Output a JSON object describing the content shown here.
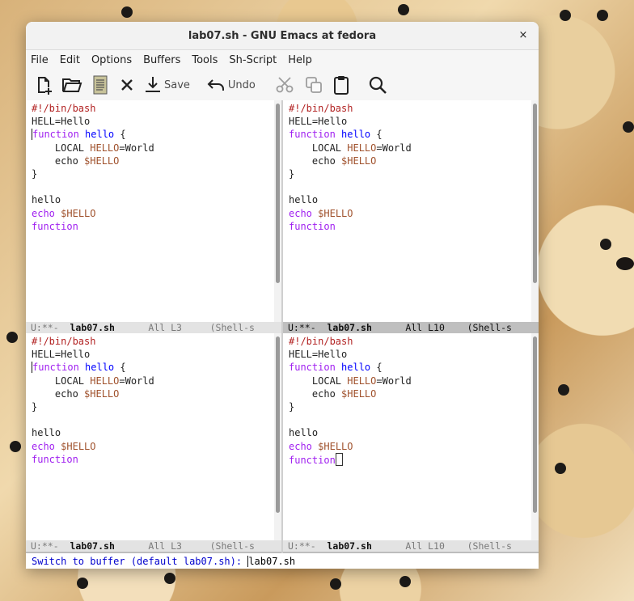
{
  "window": {
    "title": "lab07.sh - GNU Emacs at fedora",
    "close_glyph": "×"
  },
  "menu": [
    "File",
    "Edit",
    "Options",
    "Buffers",
    "Tools",
    "Sh-Script",
    "Help"
  ],
  "toolbar": {
    "new_icon": "new-file-icon",
    "open_icon": "open-folder-icon",
    "dired_icon": "document-icon",
    "close_icon": "close-icon",
    "save_label": "Save",
    "undo_label": "Undo",
    "cut_icon": "scissors-icon",
    "copy_icon": "copy-icon",
    "paste_icon": "clipboard-icon",
    "search_icon": "search-icon"
  },
  "buffer": {
    "lines": [
      "#!/bin/bash",
      "HELL=Hello",
      "function hello {",
      "    LOCAL HELLO=World",
      "    echo $HELLO",
      "}",
      "",
      "hello",
      "echo $HELLO",
      "function"
    ]
  },
  "modelines": {
    "top_left": {
      "status": "U:**-",
      "name": "lab07.sh",
      "pos": "All L3",
      "mode": "(Shell-s"
    },
    "top_right": {
      "status": "U:**-",
      "name": "lab07.sh",
      "pos": "All L10",
      "mode": "(Shell-s"
    },
    "bottom_left": {
      "status": "U:**-",
      "name": "lab07.sh",
      "pos": "All L3",
      "mode": "(Shell-s"
    },
    "bottom_right": {
      "status": "U:**-",
      "name": "lab07.sh",
      "pos": "All L10",
      "mode": "(Shell-s"
    }
  },
  "minibuffer": {
    "prompt": "Switch to buffer (default lab07.sh):",
    "input": "lab07.sh"
  },
  "colors": {
    "keyword": "#a020f0",
    "function_name": "#0000ff",
    "variable": "#a0522d",
    "comment": "#b22222",
    "prompt": "#0000cd"
  }
}
